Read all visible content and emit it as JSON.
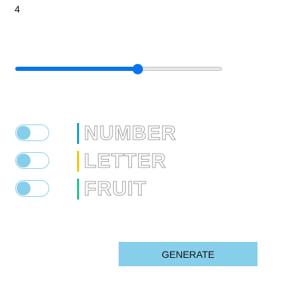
{
  "count": "4",
  "slider": {
    "value": 0.59
  },
  "options": [
    {
      "label": "NUMBER",
      "accent": "#1aa0c7",
      "enabled": false
    },
    {
      "label": "LETTER",
      "accent": "#f5c800",
      "enabled": false
    },
    {
      "label": "FRUIT",
      "accent": "#1fc48c",
      "enabled": false
    }
  ],
  "colors": {
    "slider_accent": "#0a74f0",
    "toggle_knob": "#87ceeb",
    "button_bg": "#87ceeb"
  },
  "actions": {
    "generate_label": "GENERATE"
  }
}
